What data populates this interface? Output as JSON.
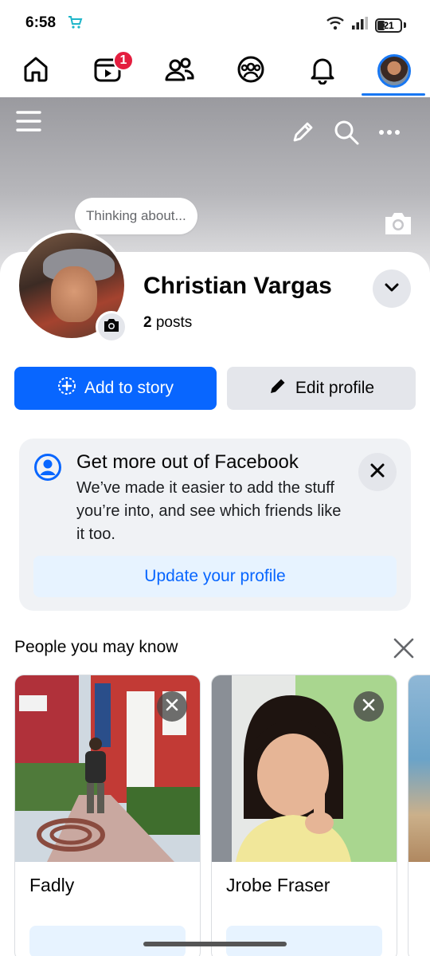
{
  "status_bar": {
    "time": "6:58",
    "battery": "21"
  },
  "tabs": [
    {
      "name": "home"
    },
    {
      "name": "video",
      "badge": "1"
    },
    {
      "name": "friends"
    },
    {
      "name": "groups"
    },
    {
      "name": "notifications"
    },
    {
      "name": "profile"
    }
  ],
  "profile": {
    "thought_bubble": "Thinking about...",
    "name": "Christian Vargas",
    "posts_count": "2",
    "posts_label": "posts",
    "add_story_label": "Add to story",
    "edit_profile_label": "Edit profile"
  },
  "info_card": {
    "title": "Get more out of Facebook",
    "body": "We’ve made it easier to add the stuff you’re into, and see which friends like it too.",
    "button_label": "Update your profile"
  },
  "pymk": {
    "title": "People you may know",
    "people": [
      {
        "name": "Fadly"
      },
      {
        "name": "Jrobe Fraser"
      }
    ]
  },
  "colors": {
    "accent": "#0866ff",
    "badge": "#e41e3f"
  }
}
